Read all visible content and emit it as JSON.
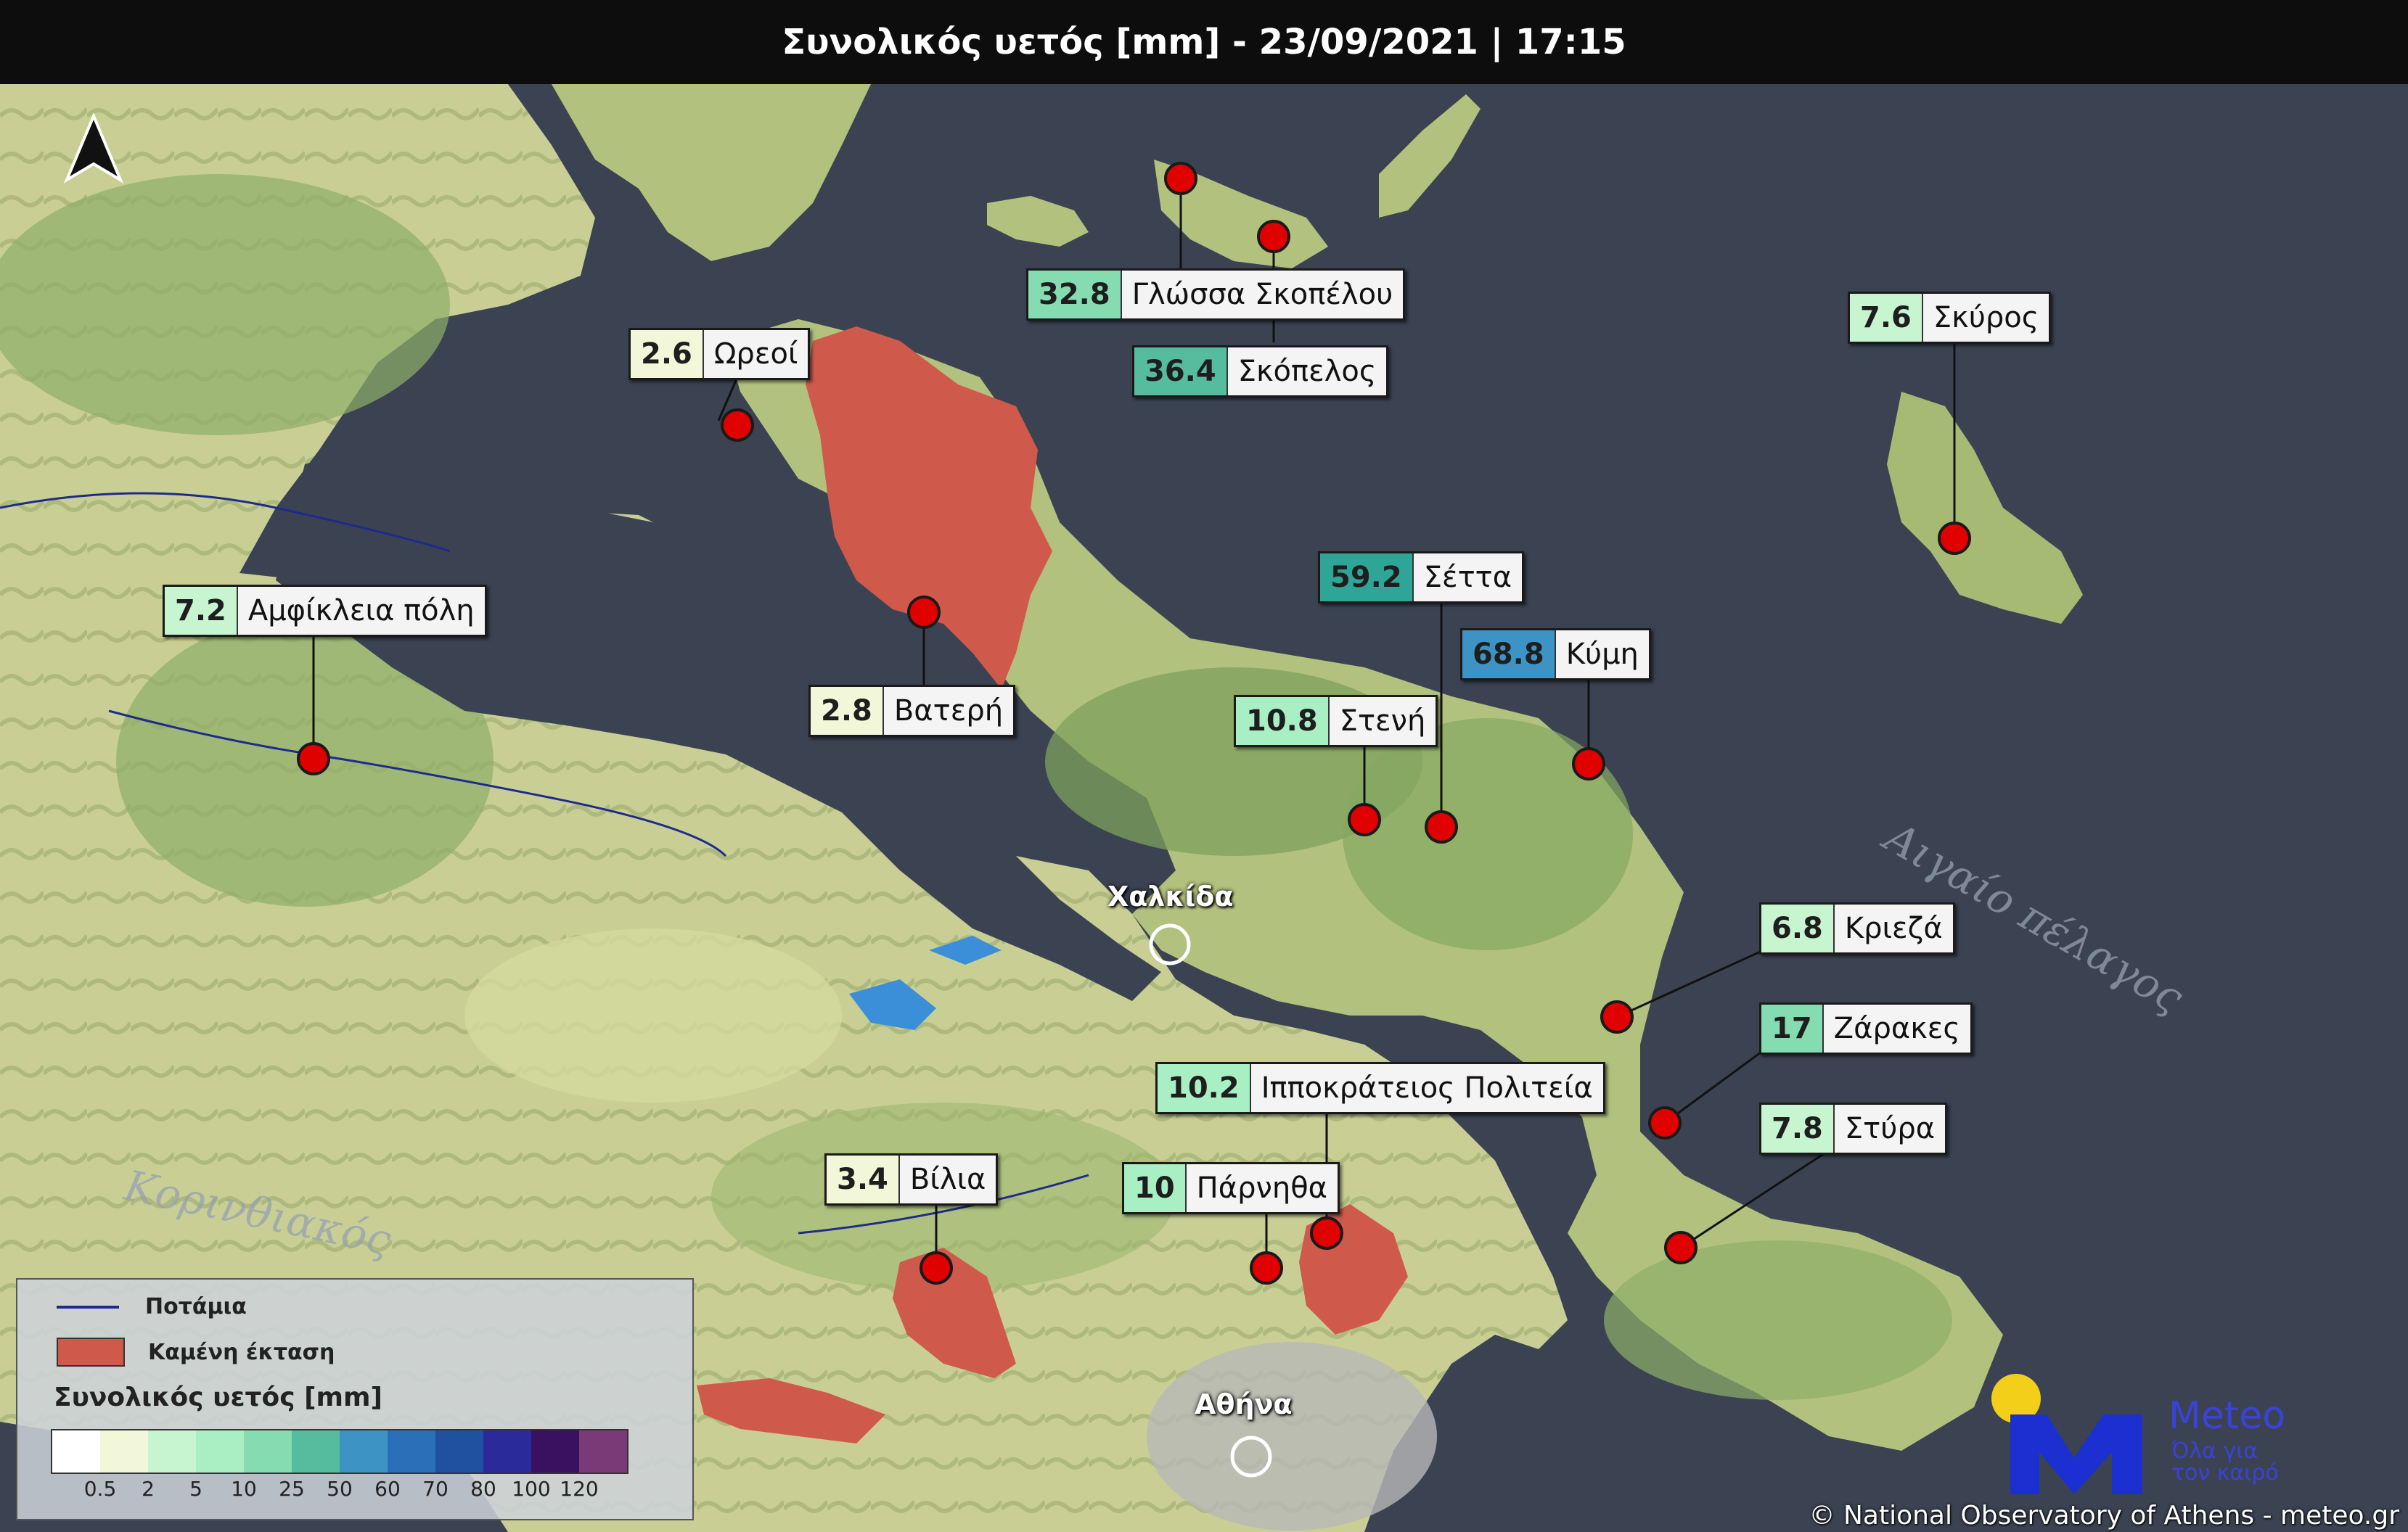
{
  "title": "Συνολικός υετός [mm] - 23/09/2021 | 17:15",
  "colors": {
    "sea": "#3b4352",
    "land": "#c9cf94",
    "burned": "#cf5a4c",
    "river": "#1f2a8a",
    "station": "#e00000"
  },
  "stations": [
    {
      "value": "2.6",
      "name": "Ωρεοί",
      "color": "#f2f7d9"
    },
    {
      "value": "32.8",
      "name": "Γλώσσα Σκοπέλου",
      "color": "#84dcb0"
    },
    {
      "value": "36.4",
      "name": "Σκόπελος",
      "color": "#55bc9e"
    },
    {
      "value": "7.6",
      "name": "Σκύρος",
      "color": "#c6f5d0"
    },
    {
      "value": "7.2",
      "name": "Αμφίκλεια πόλη",
      "color": "#c6f5d0"
    },
    {
      "value": "2.8",
      "name": "Βατερή",
      "color": "#f2f7d9"
    },
    {
      "value": "59.2",
      "name": "Σέττα",
      "color": "#2fa597"
    },
    {
      "value": "68.8",
      "name": "Κύμη",
      "color": "#3d94c4"
    },
    {
      "value": "10.8",
      "name": "Στενή",
      "color": "#a8efc4"
    },
    {
      "value": "6.8",
      "name": "Κριεζά",
      "color": "#c6f5d0"
    },
    {
      "value": "17",
      "name": "Ζάρακες",
      "color": "#84dcb0"
    },
    {
      "value": "10.2",
      "name": "Ιπποκράτειος Πολιτεία",
      "color": "#a8efc4"
    },
    {
      "value": "7.8",
      "name": "Στύρα",
      "color": "#c6f5d0"
    },
    {
      "value": "3.4",
      "name": "Βίλια",
      "color": "#f2f7d9"
    },
    {
      "value": "10",
      "name": "Πάρνηθα",
      "color": "#a8efc4"
    }
  ],
  "cities": {
    "chalkida": "Χαλκίδα",
    "athens": "Αθήνα"
  },
  "seas": {
    "aegean": "Αιγαίο πέλαγος",
    "corinthian": "Κορινθιακός"
  },
  "legend": {
    "rivers": "Ποτάμια",
    "burned": "Καμένη έκταση",
    "title": "Συνολικός υετός [mm]",
    "scale_colors": [
      "#ffffff",
      "#f2f7d9",
      "#c6f5d0",
      "#a8efc4",
      "#84dcb0",
      "#55bc9e",
      "#3d94c4",
      "#2a70b8",
      "#2050a0",
      "#2a2a9a",
      "#3a1060",
      "#7a3a78"
    ],
    "ticks": [
      "0.5",
      "2",
      "5",
      "10",
      "25",
      "50",
      "60",
      "70",
      "80",
      "100",
      "120"
    ]
  },
  "logo": {
    "brand": "Meteo",
    "tagline": "Όλα για τον καιρό"
  },
  "credit": "© National Observatory of Athens - meteo.gr"
}
